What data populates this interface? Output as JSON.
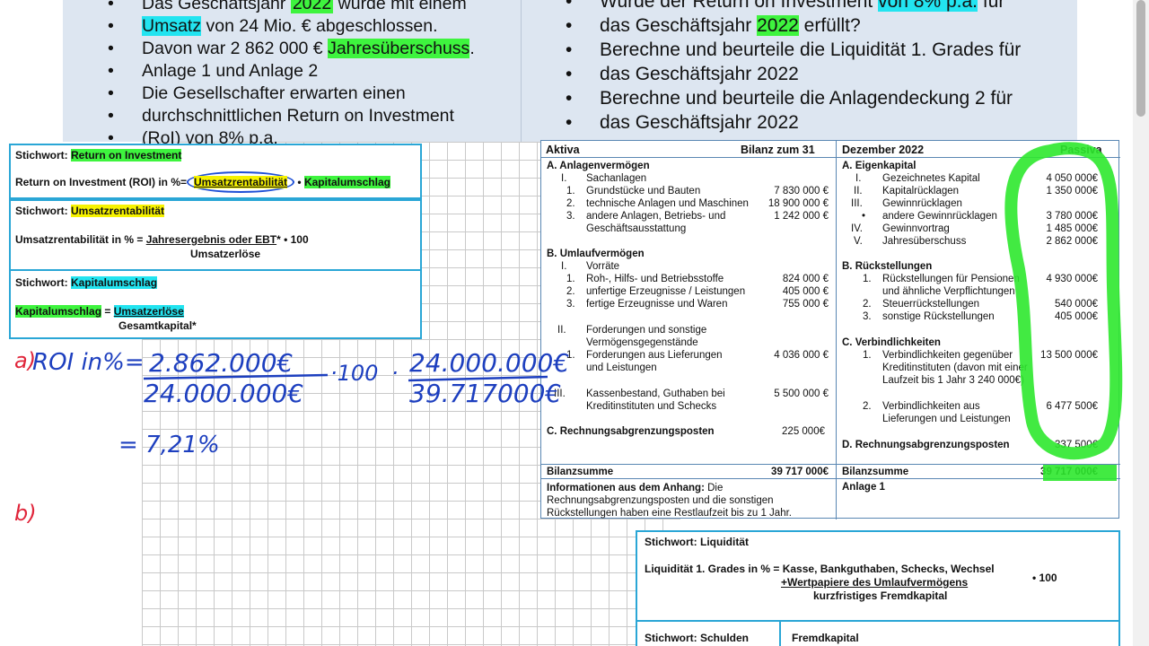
{
  "task_left": {
    "items": [
      {
        "pre": "Das Geschäftsjahr ",
        "hl": "2022",
        "post": " wurde mit einem"
      },
      {
        "pre": "",
        "hl": "Umsatz",
        "post": " von 24 Mio. € abgeschlossen."
      },
      {
        "pre": "Davon war 2 862 000 € ",
        "hl": "Jahresüberschuss",
        "post": "."
      },
      {
        "pre": "Anlage 1 und Anlage 2",
        "hl": "",
        "post": ""
      },
      {
        "pre": "Die Gesellschafter erwarten einen",
        "hl": "",
        "post": ""
      },
      {
        "pre": "durchschnittlichen Return on Investment",
        "hl": "",
        "post": ""
      },
      {
        "pre": "(RoI) von 8% p.a.",
        "hl": "",
        "post": ""
      }
    ]
  },
  "task_right": {
    "line1_pre": "Wurde der Return on Investment ",
    "line1_hl": "von 8% p.a.",
    "line1_post": " für",
    "line2_pre": "das Geschäftsjahr ",
    "line2_hl": "2022",
    "line2_post": " erfüllt?",
    "q2a": "Berechne und beurteile die Liquidität 1. Grades für",
    "q2b": "das Geschäftsjahr 2022",
    "q3a": "Berechne und beurteile die Anlagendeckung 2 für",
    "q3b": "das Geschäftsjahr 2022"
  },
  "formulas": {
    "roi_kw": "Stichwort: ",
    "roi_kw_hl": "Return on Investment",
    "roi_lhs": "Return on Investment (ROI) in %=",
    "roi_term1": "Umsatzrentabilität",
    "roi_dot": "•",
    "roi_term2": "Kapitalumschlag",
    "ur_kw": "Stichwort: ",
    "ur_kw_hl": "Umsatzrentabilität",
    "ur_lhs": "Umsatzrentabilität in % = ",
    "ur_num": "Jahresergebnis oder EBT",
    "ur_mul": "* • 100",
    "ur_den": "Umsatzerlöse",
    "ku_kw": "Stichwort: ",
    "ku_kw_hl": "Kapitalumschlag",
    "ku_lhs": "Kapitalumschlag",
    "ku_eq": " = ",
    "ku_num": "Umsatzerlöse",
    "ku_den": "Gesamtkapital*"
  },
  "bilanz": {
    "aktiva": "Aktiva",
    "title": "Bilanz zum 31",
    "title2": "Dezember 2022",
    "passiva": "Passiva",
    "a_anlage": "A. Anlagenvermögen",
    "a_I": "I.",
    "a_sach": "Sachanlagen",
    "a1n": "1.",
    "a1": "Grundstücke und Bauten",
    "a1v": "7 830 000 €",
    "a2n": "2.",
    "a2": "technische Anlagen und Maschinen",
    "a2v": "18 900 000 €",
    "a3n": "3.",
    "a3a": "andere Anlagen, Betriebs- und",
    "a3b": "Geschäftsausstattung",
    "a3v": "1 242 000 €",
    "b_umlauf": "B. Umlaufvermögen",
    "b_I": "I.",
    "b_vorr": "Vorräte",
    "b1n": "1.",
    "b1": "Roh-, Hilfs- und Betriebsstoffe",
    "b1v": "824 000 €",
    "b2n": "2.",
    "b2": "unfertige Erzeugnisse / Leistungen",
    "b2v": "405 000 €",
    "b3n": "3.",
    "b3": "fertige Erzeugnisse und Waren",
    "b3v": "755 000 €",
    "b_II": "II.",
    "b_forda": "Forderungen und sonstige",
    "b_fordb": "Vermögensgegenstände",
    "b4n": "1.",
    "b4a": "Forderungen aus Lieferungen",
    "b4b": "und Leistungen",
    "b4v": "4 036 000 €",
    "b_III": "III.",
    "b5a": "Kassenbestand, Guthaben bei",
    "b5b": "Kreditinstituten und Schecks",
    "b5v": "5 500 000 €",
    "c_rap": "C. Rechnungsabgrenzungsposten",
    "c_v": "225 000€",
    "p_ek": "A. Eigenkapital",
    "p1n": "I.",
    "p1": "Gezeichnetes Kapital",
    "p1v": "4 050 000€",
    "p2n": "II.",
    "p2": "Kapitalrücklagen",
    "p2v": "1 350 000€",
    "p3n": "III.",
    "p3": "Gewinnrücklagen",
    "p4n": "•",
    "p4": "andere Gewinnrücklagen",
    "p4v": "3 780 000€",
    "p5n": "IV.",
    "p5": "Gewinnvortrag",
    "p5v": "1 485 000€",
    "p6n": "V.",
    "p6": "Jahresüberschuss",
    "p6v": "2 862 000€",
    "p_rs": "B. Rückstellungen",
    "r1n": "1.",
    "r1a": "Rückstellungen für Pensionen",
    "r1b": "und ähnliche Verpflichtungen",
    "r1v": "4 930 000€",
    "r2n": "2.",
    "r2": "Steuerrückstellungen",
    "r2v": "540 000€",
    "r3n": "3.",
    "r3": "sonstige Rückstellungen",
    "r3v": "405 000€",
    "p_vb": "C. Verbindlichkeiten",
    "v1n": "1.",
    "v1a": "Verbindlichkeiten gegenüber",
    "v1b": "Kreditinstituten (davon mit einer",
    "v1c": "Laufzeit bis 1 Jahr 3 240 000€)",
    "v1v": "13 500 000€",
    "v2n": "2.",
    "v2a": "Verbindlichkeiten aus",
    "v2b": "Lieferungen und Leistungen",
    "v2v": "6 477 500€",
    "p_rap": "D. Rechnungsabgrenzungsposten",
    "p_rapv": "337 500€",
    "sum_l": "Bilanzsumme",
    "sum_lv": "39 717 000€",
    "sum_r": "Bilanzsumme",
    "sum_rv": "39 717 000€",
    "info_b": "Informationen aus dem Anhang:",
    "info1": " Die",
    "info2": "Rechnungsabgrenzungsposten und die sonstigen",
    "info3": "Rückstellungen haben eine Restlaufzeit bis zu 1 Jahr.",
    "anlage": "Anlage 1"
  },
  "liquiditaet": {
    "kw": "Stichwort: Liquidität",
    "lhs": "Liquidität 1. Grades in % = ",
    "num1": "Kasse, Bankguthaben, Schecks, Wechsel",
    "num2": "+Wertpapiere des Umlaufvermögens",
    "den": "kurzfristiges Fremdkapital",
    "mul": "• 100",
    "kw2": "Stichwort: Schulden",
    "fk": "Fremdkapital"
  },
  "handwriting": {
    "label_a": "a)",
    "roi": "ROI in%=",
    "num1": "2.862.000€",
    "den1": "24.000.000€",
    "mul100": "·100",
    "dot": "·",
    "num2": "24.000.000€",
    "den2": "39.717000€",
    "result": "= 7,21%",
    "label_b": "b)"
  }
}
